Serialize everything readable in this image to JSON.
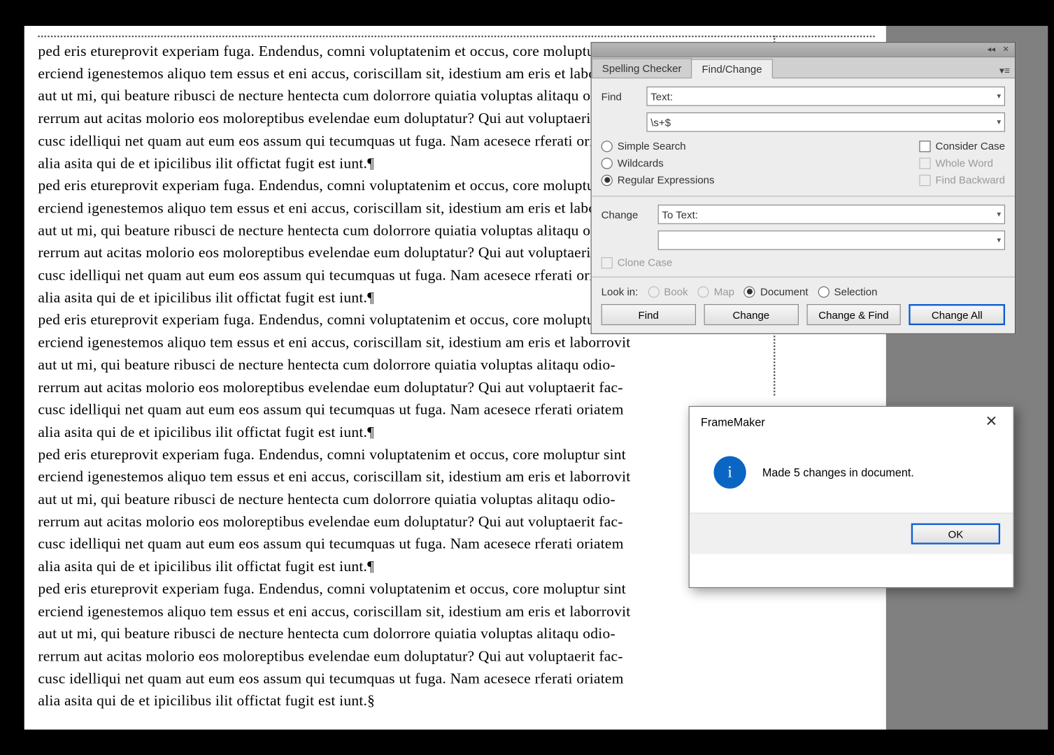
{
  "doc_paragraph": "ped eris etureprovit experiam fuga. Endendus, comni voluptatenim et occus, core moluptur sint\nerciend igenestemos aliquo tem essus et eni accus, coriscillam sit, idestium am eris et laborrovit\naut ut mi, qui beature ribusci de necture hentecta cum dolorrore quiatia voluptas alitaqu odio-\nrerrum aut acitas molorio eos moloreptibus evelendae eum doluptatur? Qui aut voluptaerit fac-\ncusc idelliqui net quam aut eum eos assum qui tecumquas ut fuga. Nam acesece rferati oriatem\nalia asita qui de et ipicilibus ilit offictat fugit est iunt.",
  "panel": {
    "tabs": {
      "spelling": "Spelling Checker",
      "findchange": "Find/Change"
    },
    "find_label": "Find",
    "find_type": "Text:",
    "find_value": "\\s+$",
    "search_modes": {
      "simple": "Simple Search",
      "wildcards": "Wildcards",
      "regex": "Regular Expressions"
    },
    "opts": {
      "case": "Consider Case",
      "whole": "Whole Word",
      "backward": "Find Backward"
    },
    "change_label": "Change",
    "change_type": "To Text:",
    "change_value": "",
    "clone_case": "Clone Case",
    "lookin_label": "Look in:",
    "lookin": {
      "book": "Book",
      "map": "Map",
      "document": "Document",
      "selection": "Selection"
    },
    "buttons": {
      "find": "Find",
      "change": "Change",
      "changefind": "Change & Find",
      "changeall": "Change All"
    }
  },
  "dialog": {
    "title": "FrameMaker",
    "message": "Made 5 changes in document.",
    "ok": "OK"
  }
}
